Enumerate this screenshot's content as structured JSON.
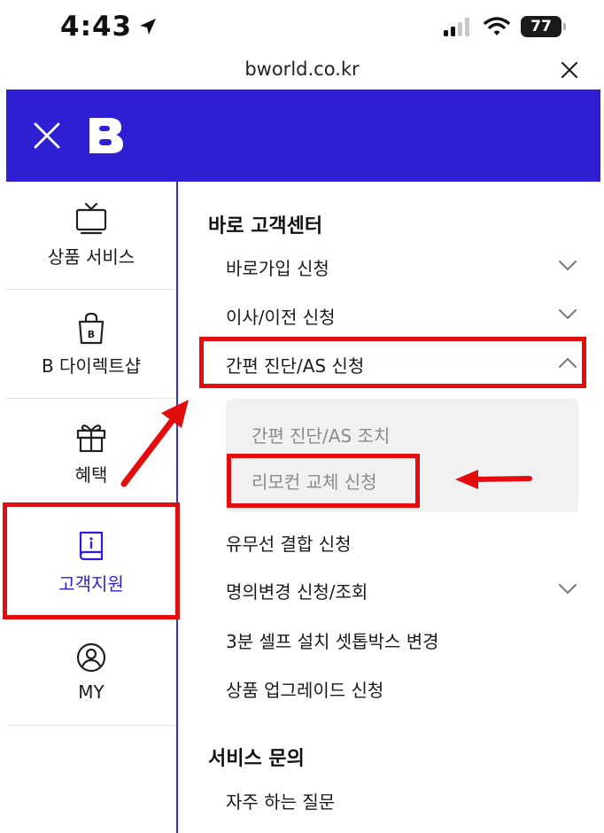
{
  "status_bar": {
    "time": "4:43",
    "battery": "77"
  },
  "url_bar": {
    "url": "bworld.co.kr"
  },
  "header": {
    "logo_letter": "B",
    "brand_color": "#2f1fd3"
  },
  "sidebar": {
    "items": [
      {
        "label": "상품 서비스",
        "icon": "tv-icon"
      },
      {
        "label": "B 다이렉트샵",
        "icon": "shopping-bag-icon"
      },
      {
        "label": "혜택",
        "icon": "gift-icon"
      },
      {
        "label": "고객지원",
        "icon": "book-info-icon",
        "active": true
      },
      {
        "label": "MY",
        "icon": "user-circle-icon"
      }
    ]
  },
  "menu": {
    "section1_title": "바로 고객센터",
    "items": [
      {
        "label": "바로가입 신청",
        "expand": "chevron-down-icon"
      },
      {
        "label": "이사/이전 신청",
        "expand": "chevron-down-icon"
      },
      {
        "label": "간편 진단/AS 신청",
        "expand": "chevron-up-icon",
        "expanded": true
      },
      {
        "label": "유무선 결합 신청"
      },
      {
        "label": "명의변경 신청/조회",
        "expand": "chevron-down-icon"
      },
      {
        "label": "3분 셀프 설치 셋톱박스 변경"
      },
      {
        "label": "상품 업그레이드 신청"
      }
    ],
    "submenu": [
      {
        "label": "간편 진단/AS 조치"
      },
      {
        "label": "리모컨 교체 신청"
      }
    ],
    "section2_title": "서비스 문의",
    "section2_items": [
      {
        "label": "자주 하는 질문"
      }
    ]
  },
  "annotation_color": "#e30d0d"
}
